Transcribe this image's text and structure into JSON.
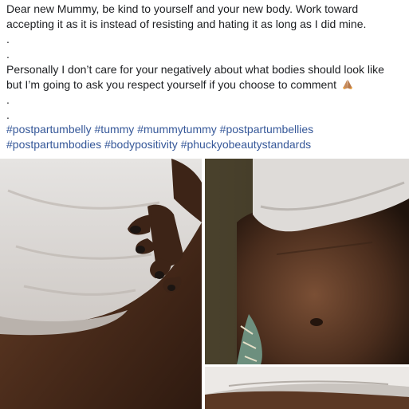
{
  "post": {
    "lines": [
      "Dear new Mummy, be kind to yourself and your new body. Work toward",
      "accepting it as it is instead of resisting and hating it as long as I did mine.",
      ".",
      ".",
      "Personally I don’t care for your negatively about what bodies should look like",
      "but I’m going to ask you respect yourself if you choose to comment",
      ".",
      "."
    ],
    "emoji": "praying-hands-icon",
    "hashtags_line1": [
      "#postpartumbelly",
      "#tummy",
      "#mummytummy",
      "#postpartumbellies"
    ],
    "hashtags_line2": [
      "#postpartumbodies",
      "#bodypositivity",
      "#phuckyobeautystandards"
    ]
  },
  "photos": [
    {
      "name": "belly-photo-left"
    },
    {
      "name": "belly-photo-right-top"
    },
    {
      "name": "belly-photo-right-bottom"
    }
  ],
  "colors": {
    "hashtag": "#365899",
    "text": "#1c1e21"
  }
}
